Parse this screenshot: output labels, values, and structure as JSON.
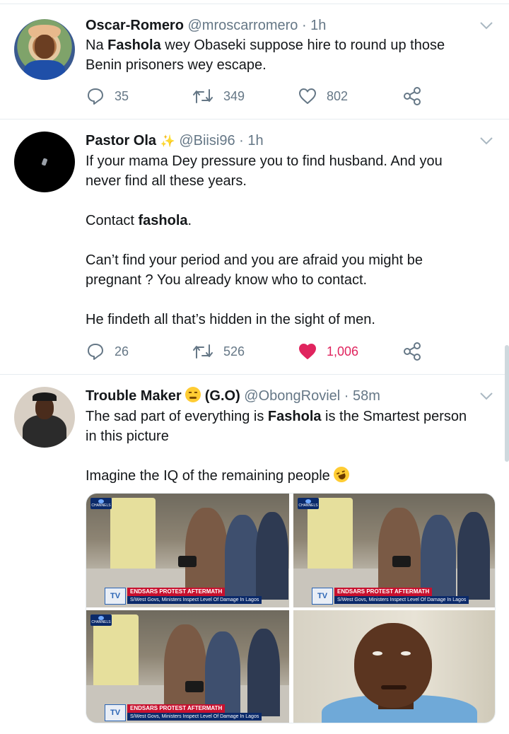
{
  "colors": {
    "text": "#14171a",
    "muted": "#657786",
    "like": "#e0245e",
    "border": "#e6ecf0"
  },
  "tweets": [
    {
      "name": "Oscar-Romero",
      "handle": "@mroscarromero",
      "time": "· 1h",
      "avatar_icon": "profile-photo",
      "lines": [
        {
          "a": "Na ",
          "b": "Fashola",
          "c": " wey Obaseki suppose hire to round up those Benin prisoners wey escape."
        }
      ],
      "replies": "35",
      "retweets": "349",
      "likes": "802",
      "liked": false
    },
    {
      "name": "Pastor Ola",
      "name_decoration": "✨",
      "handle": "@Biisi96",
      "time": "· 1h",
      "avatar_icon": "dark-profile-photo",
      "paragraphs": {
        "p1": "If your mama Dey pressure you to find husband. And you never find all these years.",
        "p2a": "Contact ",
        "p2b": "fashola",
        "p2c": ".",
        "p3": "Can’t find your period and you are afraid you might be pregnant ? You already know who to contact.",
        "p4": "He findeth all that’s hidden in the sight of men."
      },
      "replies": "26",
      "retweets": "526",
      "likes": "1,006",
      "liked": true
    },
    {
      "name": "Trouble Maker",
      "name_emoji": "unamused-face-emoji",
      "name_suffix": "(G.O)",
      "handle": "@ObongRoviel",
      "time": "· 58m",
      "avatar_icon": "profile-photo",
      "paragraphs": {
        "p1a": "The sad part of everything is ",
        "p1b": "Fashola",
        "p1c": " is the Smartest person in this picture",
        "p2": "Imagine the IQ of the remaining people",
        "p2_emoji": "rolling-laughing-emoji"
      },
      "media": {
        "ticker_line1": "ENDSARS PROTEST AFTERMATH",
        "ticker_line2": "S/West Govs, Ministers Inspect Level Of Damage In Lagos",
        "ticker_logo": "TV",
        "channel_badge": "CHANNELS"
      }
    }
  ]
}
